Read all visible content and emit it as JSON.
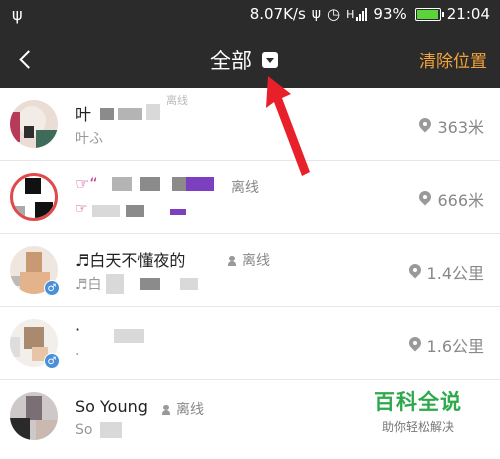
{
  "status_bar": {
    "network_speed": "8.07K/s",
    "signal": "H",
    "battery": "93%",
    "time": "21:04"
  },
  "header": {
    "title": "全部",
    "clear_label": "清除位置"
  },
  "list": [
    {
      "name": "叶",
      "sub": "叶ふ",
      "status": "离线",
      "distance": "363米"
    },
    {
      "name": "☞“",
      "sub": "☞",
      "status": "离线",
      "distance": "666米"
    },
    {
      "name": "♬白天不懂夜的",
      "sub": "♬白",
      "status": "离线",
      "distance": "1.4公里"
    },
    {
      "name": "·",
      "sub": "·",
      "status": "",
      "distance": "1.6公里"
    },
    {
      "name": "So Young",
      "sub": "So",
      "status": "离线",
      "distance": ""
    }
  ],
  "watermark": {
    "title": "百科全说",
    "subtitle": "助你轻松解决"
  },
  "colors": {
    "header_bg": "#2b2b2b",
    "accent": "#f2a33a",
    "battery": "#5bd43b",
    "arrow": "#e8202a"
  }
}
